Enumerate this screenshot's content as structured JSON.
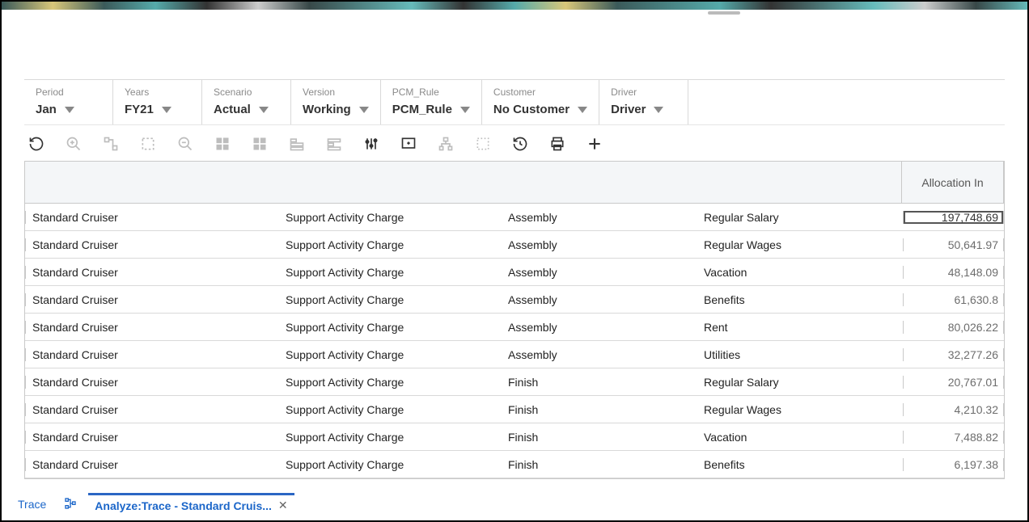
{
  "pov": [
    {
      "label": "Period",
      "value": "Jan"
    },
    {
      "label": "Years",
      "value": "FY21"
    },
    {
      "label": "Scenario",
      "value": "Actual"
    },
    {
      "label": "Version",
      "value": "Working"
    },
    {
      "label": "PCM_Rule",
      "value": "PCM_Rule"
    },
    {
      "label": "Customer",
      "value": "No Customer"
    },
    {
      "label": "Driver",
      "value": "Driver"
    }
  ],
  "grid": {
    "header_right": "Allocation In",
    "rows": [
      {
        "c1": "Standard Cruiser",
        "c2": "Support Activity Charge",
        "c3": "Assembly",
        "c4": "Regular Salary",
        "c5": "197,748.69",
        "selected": true
      },
      {
        "c1": "Standard Cruiser",
        "c2": "Support Activity Charge",
        "c3": "Assembly",
        "c4": "Regular Wages",
        "c5": "50,641.97"
      },
      {
        "c1": "Standard Cruiser",
        "c2": "Support Activity Charge",
        "c3": "Assembly",
        "c4": "Vacation",
        "c5": "48,148.09"
      },
      {
        "c1": "Standard Cruiser",
        "c2": "Support Activity Charge",
        "c3": "Assembly",
        "c4": "Benefits",
        "c5": "61,630.8"
      },
      {
        "c1": "Standard Cruiser",
        "c2": "Support Activity Charge",
        "c3": "Assembly",
        "c4": "Rent",
        "c5": "80,026.22"
      },
      {
        "c1": "Standard Cruiser",
        "c2": "Support Activity Charge",
        "c3": "Assembly",
        "c4": "Utilities",
        "c5": "32,277.26"
      },
      {
        "c1": "Standard Cruiser",
        "c2": "Support Activity Charge",
        "c3": "Finish",
        "c4": "Regular Salary",
        "c5": "20,767.01"
      },
      {
        "c1": "Standard Cruiser",
        "c2": "Support Activity Charge",
        "c3": "Finish",
        "c4": "Regular Wages",
        "c5": "4,210.32"
      },
      {
        "c1": "Standard Cruiser",
        "c2": "Support Activity Charge",
        "c3": "Finish",
        "c4": "Vacation",
        "c5": "7,488.82"
      },
      {
        "c1": "Standard Cruiser",
        "c2": "Support Activity Charge",
        "c3": "Finish",
        "c4": "Benefits",
        "c5": "6,197.38"
      }
    ]
  },
  "tabs": {
    "trace": "Trace",
    "analyze": "Analyze:Trace - Standard Cruis..."
  }
}
